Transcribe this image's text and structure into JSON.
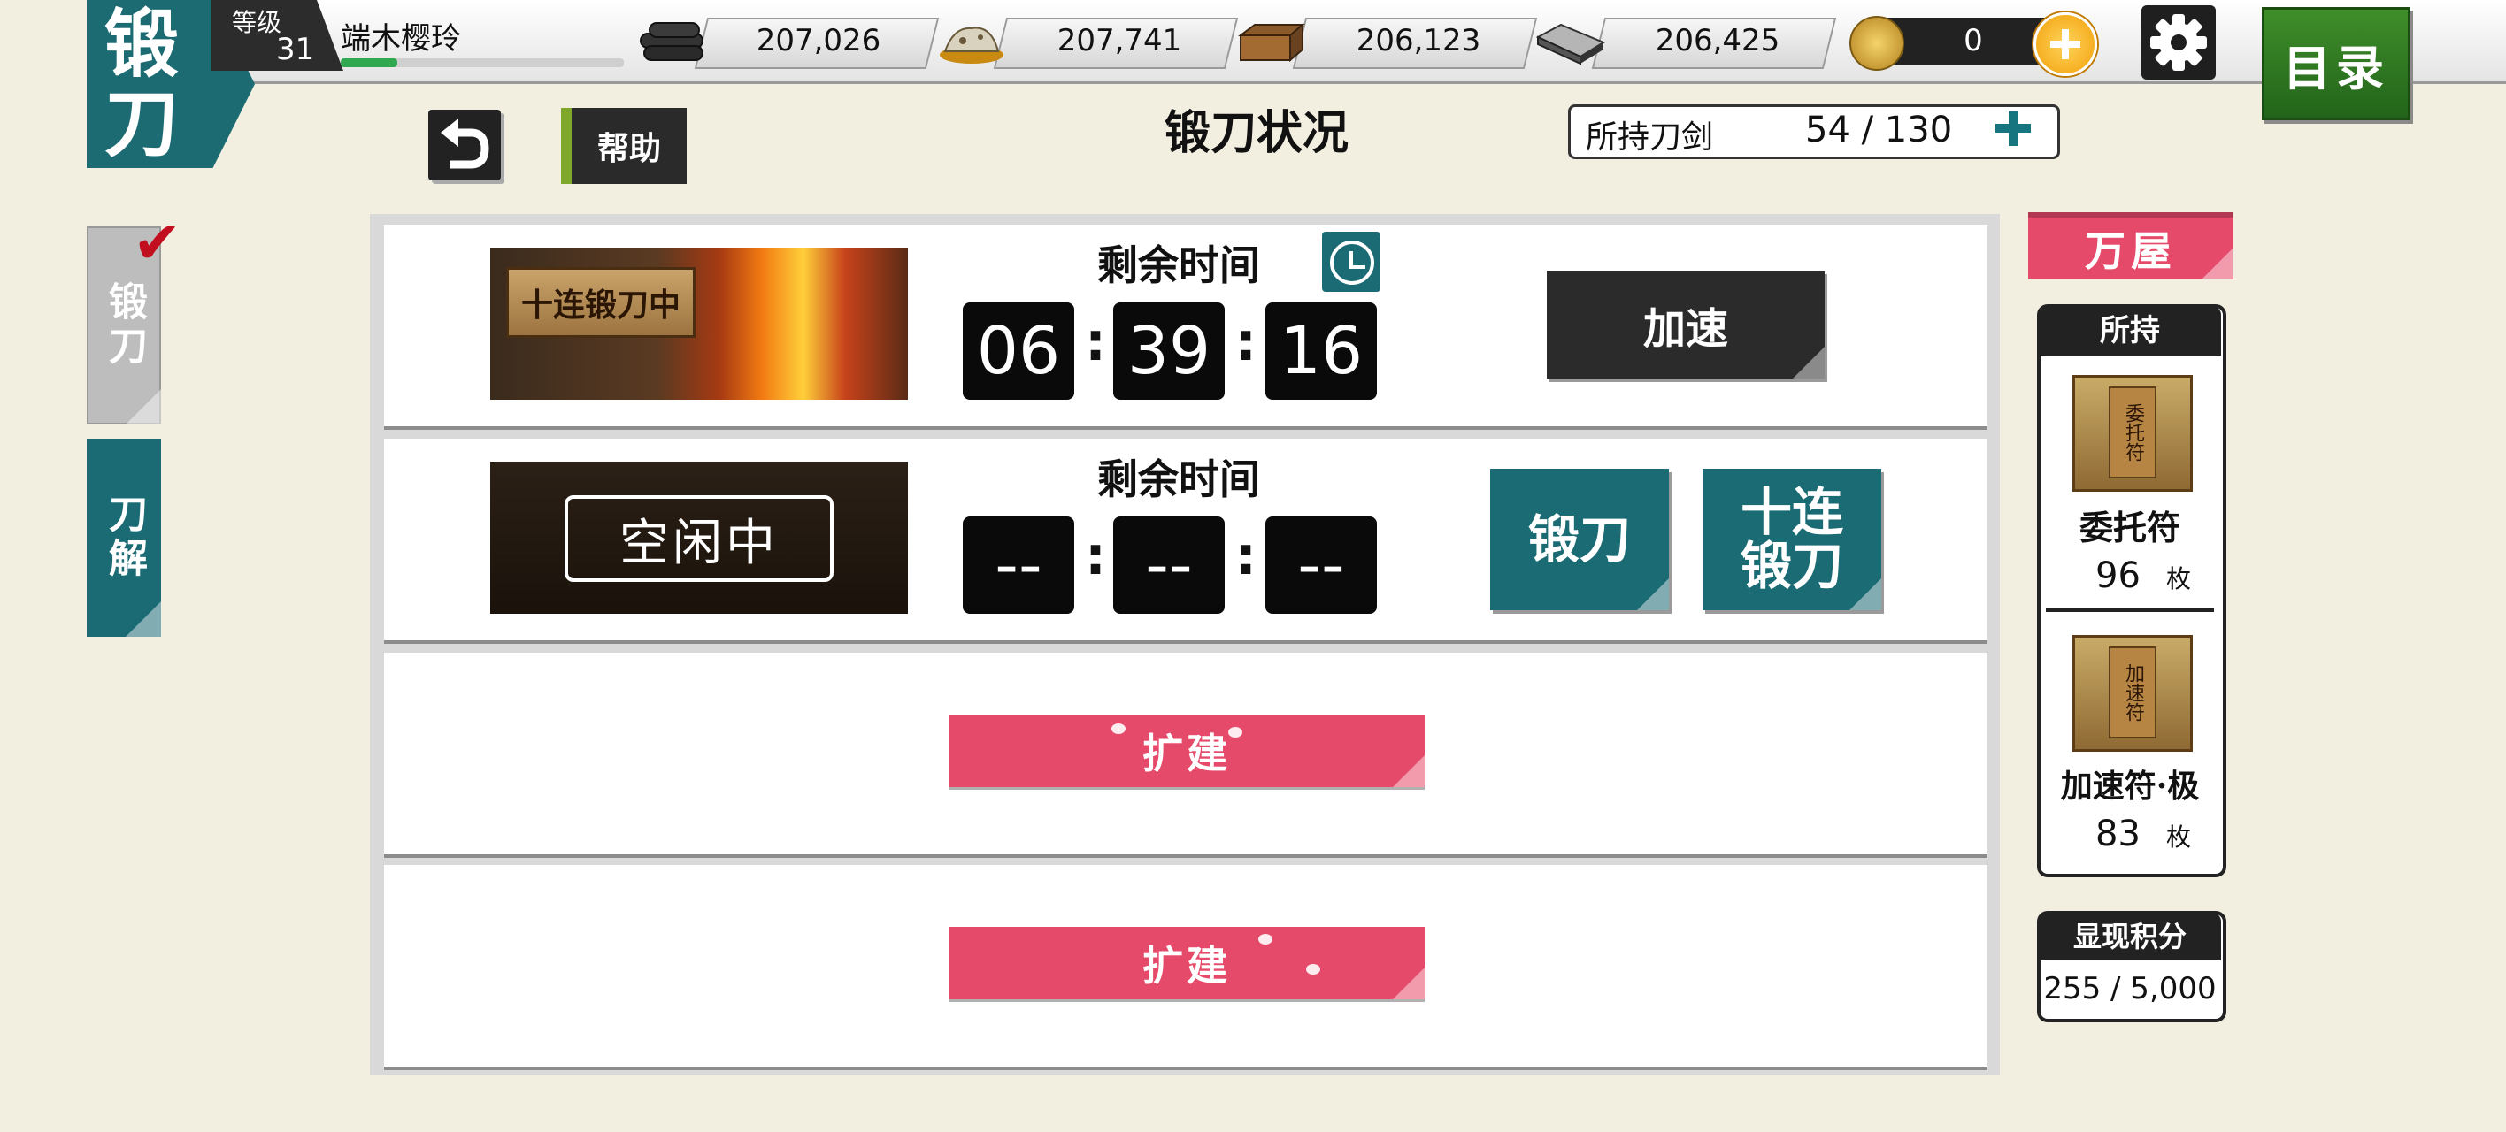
{
  "header": {
    "corner_top": "锻",
    "corner_bottom": "刀",
    "level_label": "等级",
    "level": "31",
    "player_name": "端木樱玲",
    "xp_progress": 0.2,
    "resources": [
      {
        "icon": "charcoal-icon",
        "value": "207,026"
      },
      {
        "icon": "jade-steel-icon",
        "value": "207,741"
      },
      {
        "icon": "cooling-material-icon",
        "value": "206,123"
      },
      {
        "icon": "whetstone-icon",
        "value": "206,425"
      }
    ],
    "coins": "0",
    "menu_label": "目录"
  },
  "page": {
    "title": "锻刀状况",
    "owned_swords_label": "所持刀剑",
    "owned_swords_value": "54 / 130"
  },
  "help_label": "帮助",
  "tabs": [
    {
      "label": "锻刀",
      "active": true
    },
    {
      "label": "刀解",
      "active": false
    }
  ],
  "slots": [
    {
      "state": "forging",
      "image_label": "十连锻刀中",
      "remaining_label": "剩余时间",
      "time": [
        "06",
        "39",
        "16"
      ],
      "action_label": "加速"
    },
    {
      "state": "idle",
      "image_label": "空闲中",
      "remaining_label": "剩余时间",
      "time": [
        "--",
        "--",
        "--"
      ],
      "forge_label": "锻刀",
      "forge10_label_line1": "十连",
      "forge10_label_line2": "锻刀"
    },
    {
      "state": "locked",
      "expand_label": "扩建"
    },
    {
      "state": "locked",
      "expand_label": "扩建"
    }
  ],
  "shop": {
    "ribbon_label": "万屋",
    "owned_head": "所持",
    "items": [
      {
        "tag": "委托符",
        "name": "委托符",
        "count": "96",
        "unit": "枚"
      },
      {
        "tag": "加速符",
        "name": "加速符·极",
        "count": "83",
        "unit": "枚"
      }
    ]
  },
  "score": {
    "label": "显现积分",
    "value": "255 / 5,000"
  },
  "colors": {
    "teal": "#1a6b73",
    "pink": "#e64a6b",
    "background": "#f3efe0",
    "dark": "#2b2b2b"
  }
}
